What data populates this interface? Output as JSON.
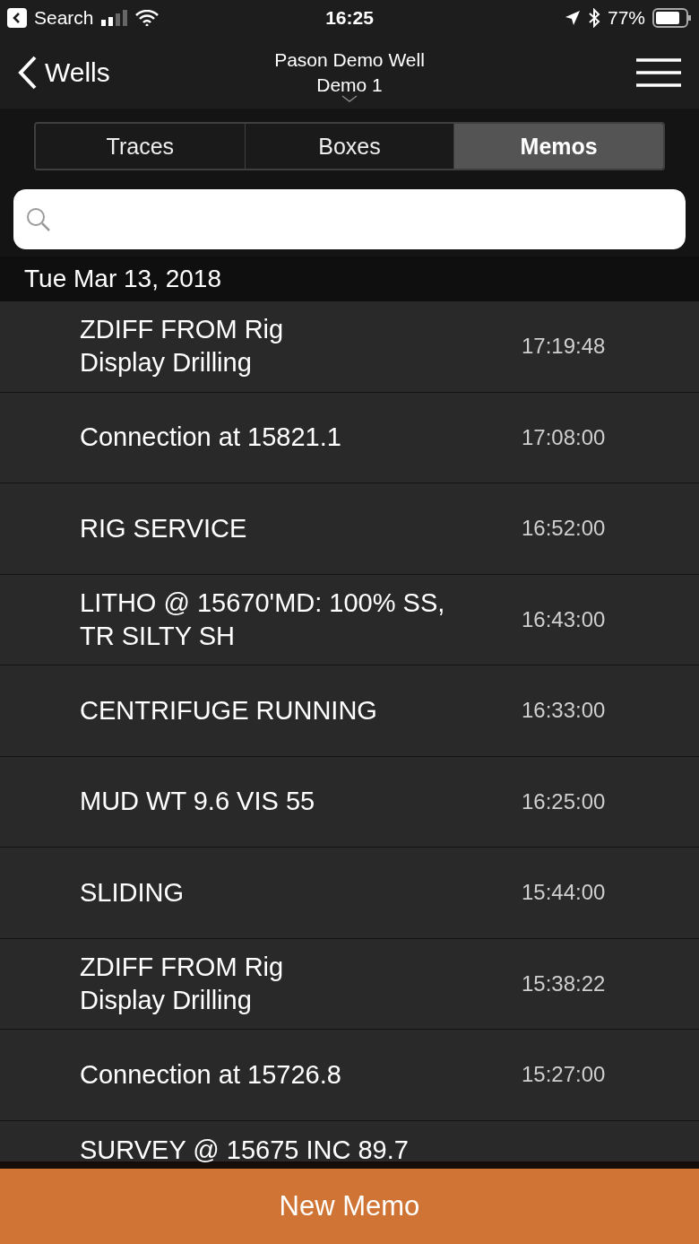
{
  "status_bar": {
    "back_label": "Search",
    "time": "16:25",
    "battery": "77%"
  },
  "nav": {
    "back": "Wells",
    "title": "Pason Demo Well",
    "subtitle": "Demo 1"
  },
  "tabs": [
    {
      "label": "Traces",
      "selected": false
    },
    {
      "label": "Boxes",
      "selected": false
    },
    {
      "label": "Memos",
      "selected": true
    }
  ],
  "section": {
    "date": "Tue Mar 13, 2018"
  },
  "memos": [
    {
      "text": "ZDIFF FROM Rig\nDisplay Drilling",
      "time": "17:19:48"
    },
    {
      "text": "Connection at 15821.1",
      "time": "17:08:00"
    },
    {
      "text": "RIG SERVICE",
      "time": "16:52:00"
    },
    {
      "text": "LITHO @ 15670'MD: 100% SS,\nTR SILTY SH",
      "time": "16:43:00"
    },
    {
      "text": "CENTRIFUGE RUNNING",
      "time": "16:33:00"
    },
    {
      "text": "MUD WT 9.6 VIS 55",
      "time": "16:25:00"
    },
    {
      "text": "SLIDING",
      "time": "15:44:00"
    },
    {
      "text": "ZDIFF FROM Rig\nDisplay Drilling",
      "time": "15:38:22"
    },
    {
      "text": "Connection at 15726.8",
      "time": "15:27:00"
    },
    {
      "text": "SURVEY @ 15675 INC 89.7"
    }
  ],
  "button": "New Memo"
}
